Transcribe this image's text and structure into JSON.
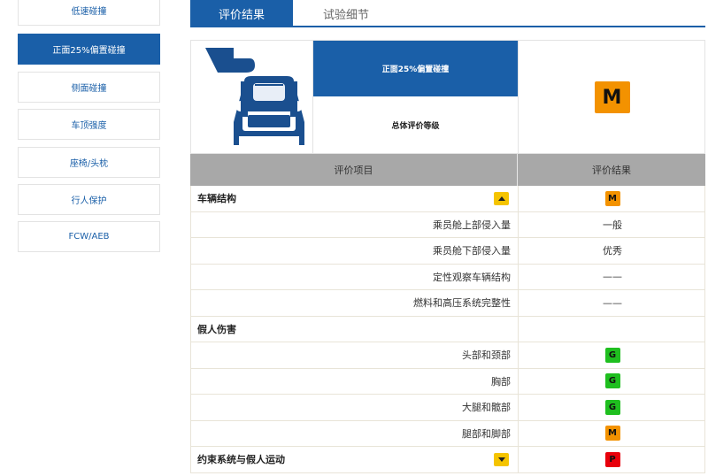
{
  "sidebar": {
    "items": [
      {
        "label": "低速碰撞",
        "active": false
      },
      {
        "label": "正面25%偏置碰撞",
        "active": true
      },
      {
        "label": "侧面碰撞",
        "active": false
      },
      {
        "label": "车顶强度",
        "active": false
      },
      {
        "label": "座椅/头枕",
        "active": false
      },
      {
        "label": "行人保护",
        "active": false
      },
      {
        "label": "FCW/AEB",
        "active": false
      }
    ]
  },
  "tabs": [
    {
      "label": "评价结果",
      "active": true
    },
    {
      "label": "试验细节",
      "active": false
    }
  ],
  "summary": {
    "test_name": "正面25%偏置碰撞",
    "overall_label": "总体评价等级",
    "overall_rating": "M",
    "car_icon": "car-front-offset-icon"
  },
  "columns": {
    "item": "评价项目",
    "result": "评价结果"
  },
  "colors": {
    "G": "#1fbf1f",
    "M": "#f39200",
    "P": "#e8000b",
    "brand": "#1a5fa8",
    "toggle": "#f5c400"
  },
  "rows": [
    {
      "type": "section",
      "label": "车辆结构",
      "toggle": "up",
      "rating": "M"
    },
    {
      "type": "sub",
      "label": "乘员舱上部侵入量",
      "text": "一般"
    },
    {
      "type": "sub",
      "label": "乘员舱下部侵入量",
      "text": "优秀"
    },
    {
      "type": "sub",
      "label": "定性观察车辆结构",
      "text": "——"
    },
    {
      "type": "sub",
      "label": "燃料和高压系统完整性",
      "text": "——"
    },
    {
      "type": "section",
      "label": "假人伤害"
    },
    {
      "type": "sub",
      "label": "头部和颈部",
      "rating": "G"
    },
    {
      "type": "sub",
      "label": "胸部",
      "rating": "G"
    },
    {
      "type": "sub",
      "label": "大腿和髋部",
      "rating": "G"
    },
    {
      "type": "sub",
      "label": "腿部和脚部",
      "rating": "M"
    },
    {
      "type": "section",
      "label": "约束系统与假人运动",
      "toggle": "down",
      "rating": "P"
    }
  ]
}
